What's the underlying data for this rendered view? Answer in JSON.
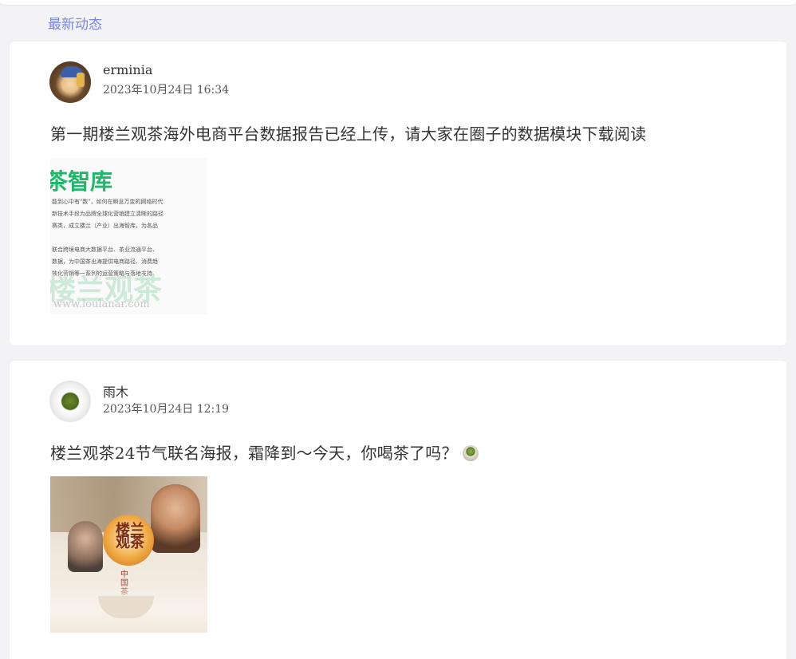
{
  "section": {
    "title": "最新动态"
  },
  "posts": [
    {
      "username": "erminia",
      "timestamp": "2023年10月24日 16:34",
      "text": "第一期楼兰观茶海外电商平台数据报告已经上传，请大家在圈子的数据模块下载阅读",
      "avatar_icon": "portrait-avatar",
      "image": {
        "title": "茶智库",
        "lines": [
          "能到心中有\"数\"，如何在瞬息万变的网络时代",
          "新技术手段为品牌全球化营销建立清晰的路径",
          "赛类，成立楼兰（产业）出海智库，为各品",
          "联合跨境电商大数据平台、茶业流通平台、",
          "数据，为中国茶出海提供电商路径、消费趋",
          "效化营销等一系列的运营策略与落地支持。"
        ],
        "watermark": "楼兰观茶",
        "url": "www.loulanar.com"
      }
    },
    {
      "username": "雨木",
      "timestamp": "2023年10月24日 12:19",
      "text": "楼兰观茶24节气联名海报，霜降到～今天，你喝茶了吗？",
      "emoji_icon": "tea-cup-emoji",
      "avatar_icon": "tea-bowl-avatar",
      "image": {
        "title": "楼兰观茶",
        "subtitle": "中国茶道"
      }
    }
  ],
  "colors": {
    "page_bg": "#f3f3f5",
    "card_bg": "#ffffff",
    "section_title": "#7a86e6",
    "brand_green": "#1fb86a"
  }
}
